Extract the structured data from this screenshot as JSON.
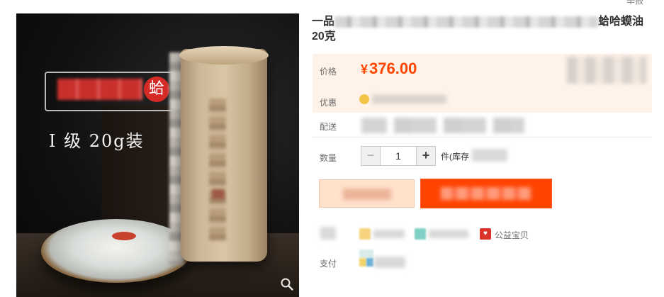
{
  "header": {
    "report_label": "举报"
  },
  "gallery": {
    "badge_char": "蛤",
    "grade_text": "I 级 20g装",
    "zoom_icon": "magnifier-icon"
  },
  "product": {
    "title_prefix": "一品",
    "title_suffix": "蛤哈蟆油",
    "title_line2": "20克"
  },
  "price": {
    "label": "价格",
    "currency": "¥",
    "value": "376.00"
  },
  "promo": {
    "label": "优惠"
  },
  "shipping": {
    "label": "配送"
  },
  "quantity": {
    "label": "数量",
    "minus": "−",
    "value": "1",
    "plus": "+",
    "unit": "件(库存"
  },
  "services": {
    "report_item_label": "公益宝贝",
    "report_icon_glyph": "♥",
    "partial_text": "三退内"
  },
  "payment": {
    "label": "支付"
  },
  "colors": {
    "price_orange": "#ff4400",
    "price_area_bg": "#fff2e8",
    "buy_button_bg": "#ffe1cc",
    "cart_button_bg": "#ff4400"
  }
}
